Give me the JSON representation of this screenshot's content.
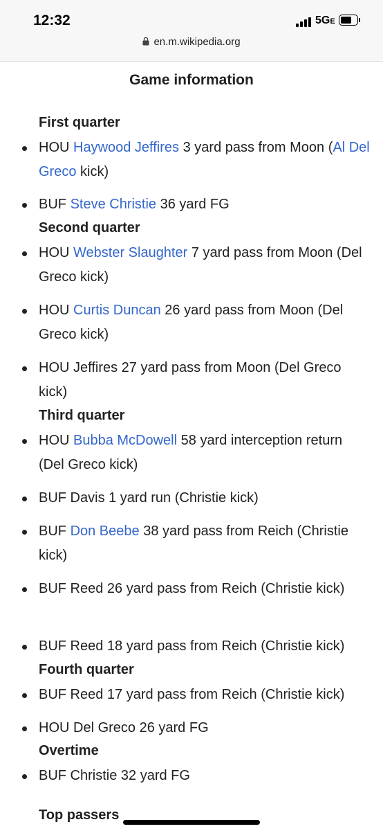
{
  "status_bar": {
    "time": "12:32",
    "network": "5G",
    "network_suffix": "E"
  },
  "address_bar": {
    "url": "en.m.wikipedia.org"
  },
  "section": {
    "title": "Game information",
    "quarters": [
      {
        "name": "First quarter",
        "plays": [
          {
            "pre": "HOU ",
            "link": "Haywood Jeffires",
            "mid": " 3 yard pass from Moon (",
            "link2": "Al Del Greco",
            "post": " kick)"
          },
          {
            "pre": "BUF ",
            "link": "Steve Christie",
            "post": " 36 yard FG"
          }
        ]
      },
      {
        "name": "Second quarter",
        "plays": [
          {
            "pre": "HOU ",
            "link": "Webster Slaughter",
            "post": " 7 yard pass from Moon (Del Greco kick)"
          },
          {
            "pre": "HOU ",
            "link": "Curtis Duncan",
            "post": " 26 yard pass from Moon (Del Greco kick)"
          },
          {
            "text": "HOU Jeffires 27 yard pass from Moon (Del Greco kick)"
          }
        ]
      },
      {
        "name": "Third quarter",
        "plays": [
          {
            "pre": "HOU ",
            "link": "Bubba McDowell",
            "post": " 58 yard interception return (Del Greco kick)"
          },
          {
            "text": "BUF Davis 1 yard run (Christie kick)"
          },
          {
            "pre": "BUF ",
            "link": "Don Beebe",
            "post": " 38 yard pass from Reich (Christie kick)"
          },
          {
            "text": "BUF Reed 26 yard pass from Reich (Christie kick)"
          },
          {
            "text": "BUF Reed 18 yard pass from Reich (Christie kick)"
          }
        ]
      },
      {
        "name": "Fourth quarter",
        "plays": [
          {
            "text": "BUF Reed 17 yard pass from Reich (Christie kick)"
          },
          {
            "text": "HOU Del Greco 26 yard FG"
          }
        ]
      },
      {
        "name": "Overtime",
        "plays": [
          {
            "text": "BUF Christie 32 yard FG"
          }
        ]
      }
    ],
    "next_heading": "Top passers"
  }
}
